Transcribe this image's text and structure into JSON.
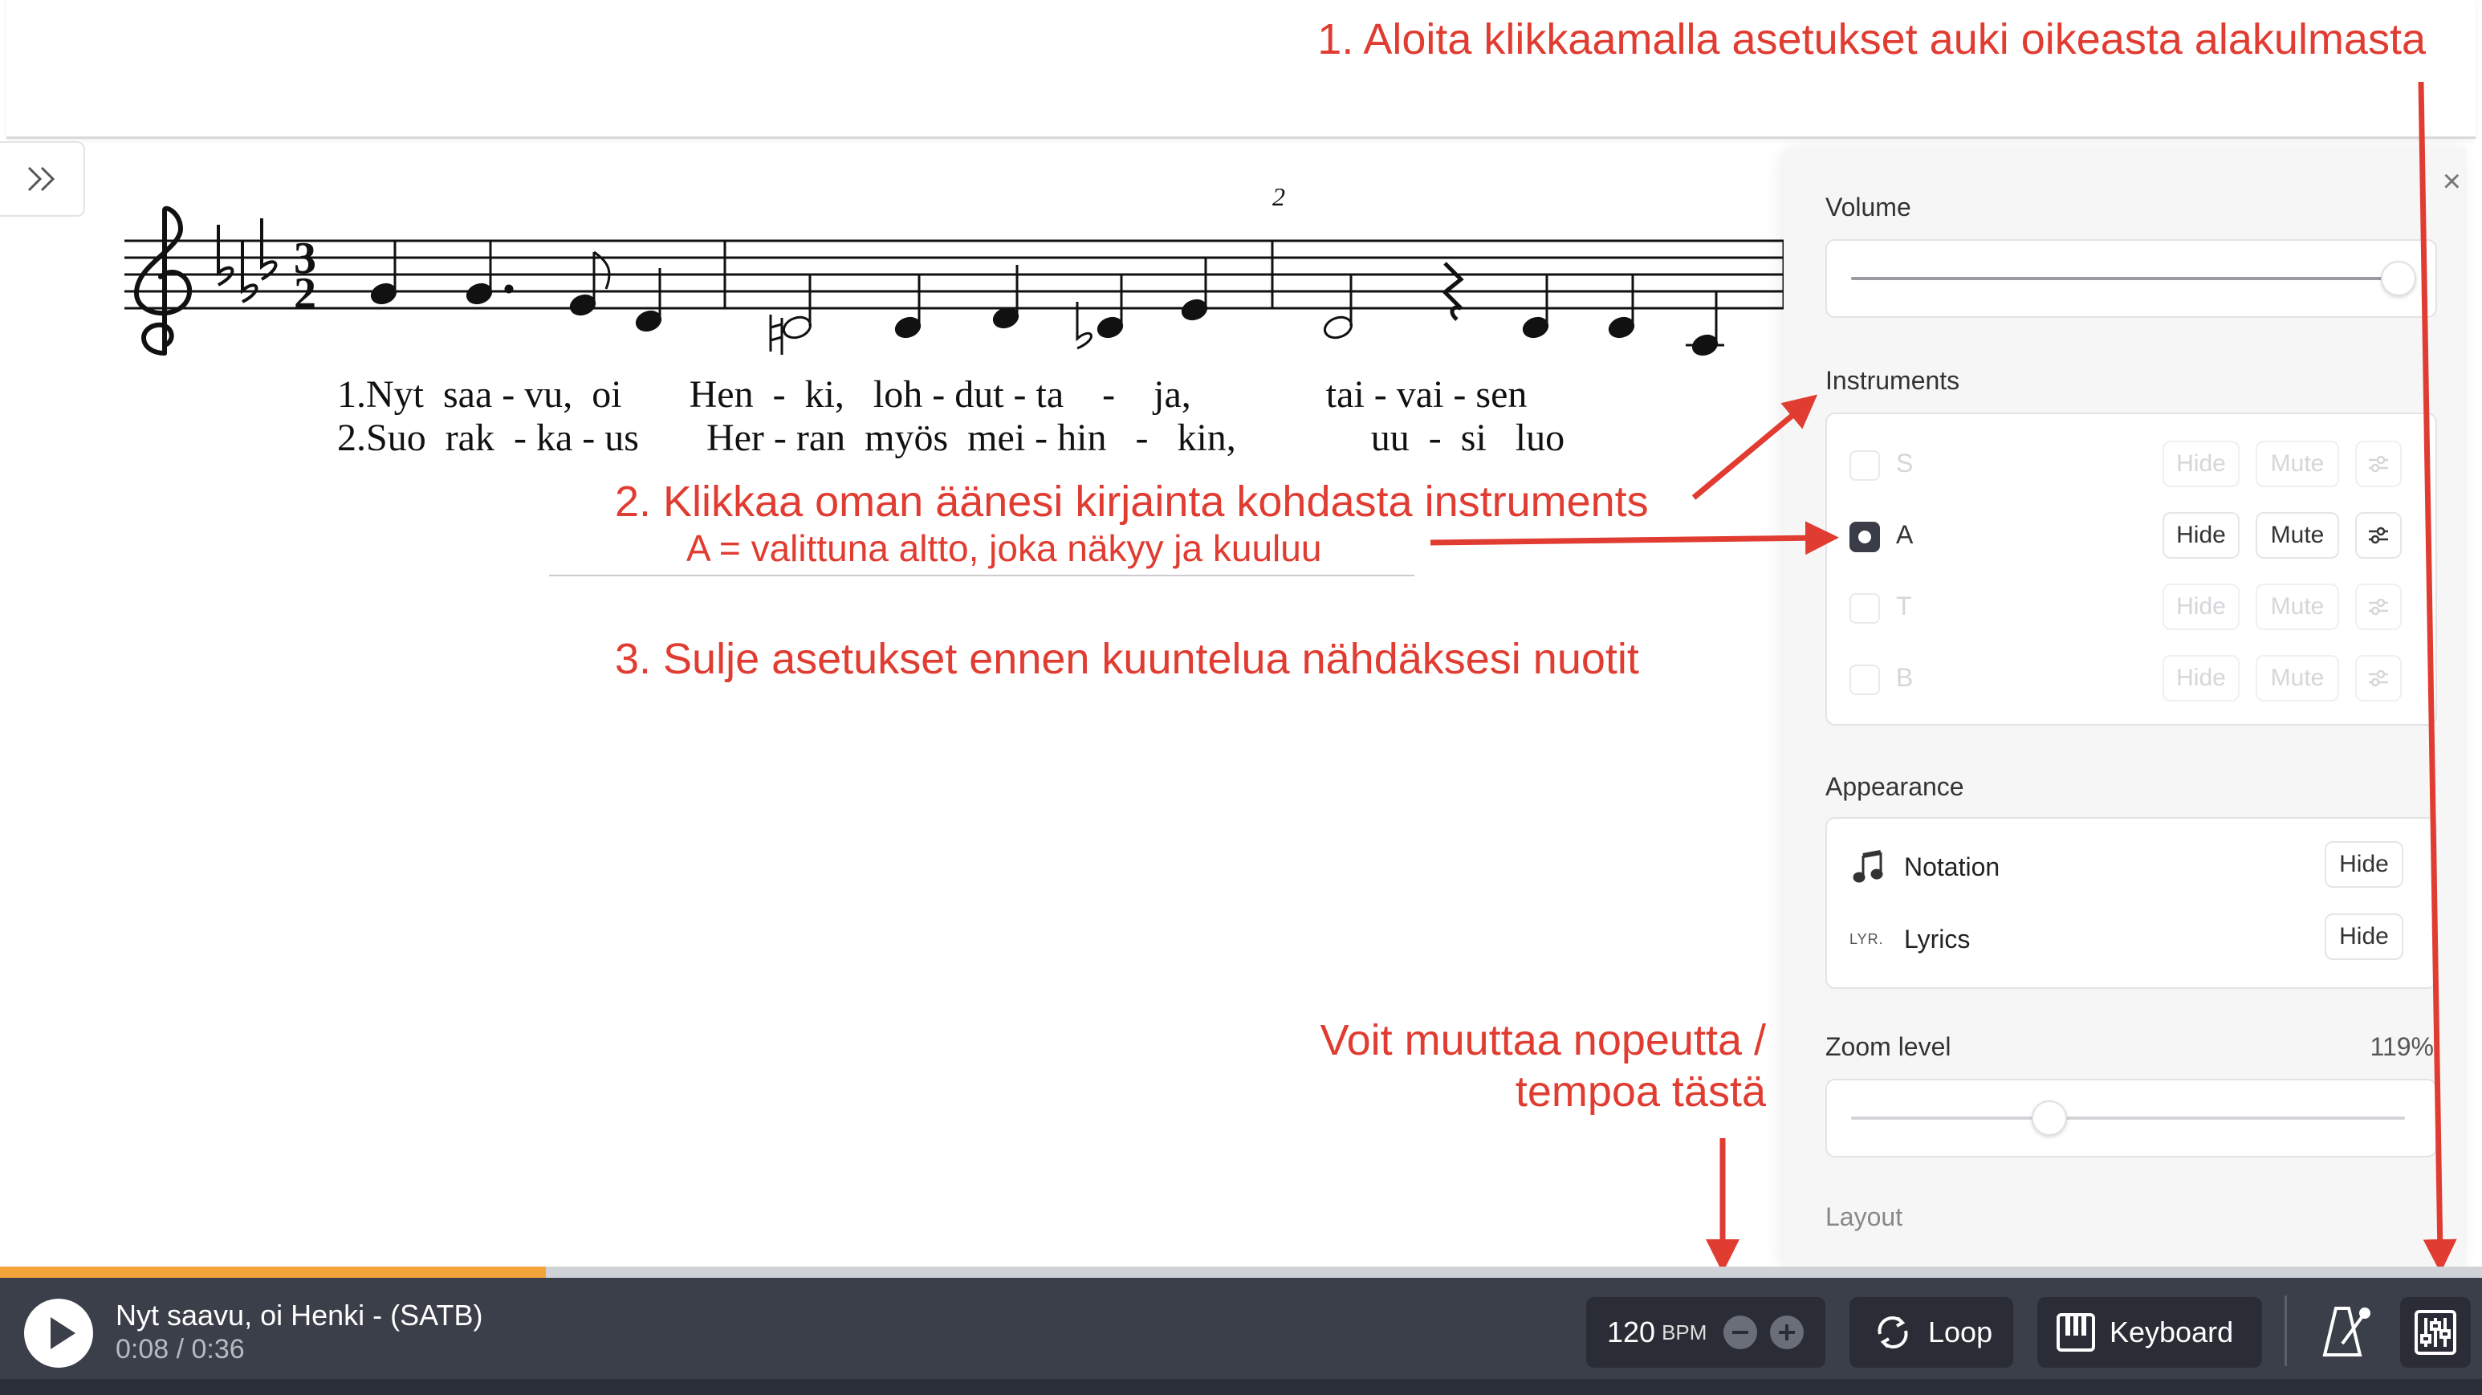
{
  "annotations": {
    "step1": "1. Aloita klikkaamalla asetukset auki oikeasta alakulmasta",
    "step2": "2. Klikkaa oman äänesi kirjainta kohdasta instruments",
    "step2_sub": "A = valittuna altto, joka näkyy ja kuuluu",
    "step3": "3. Sulje asetukset ennen kuuntelua nähdäksesi nuotit",
    "tempo_line1": "Voit muuttaa nopeutta /",
    "tempo_line2": "tempoa tästä"
  },
  "score": {
    "measure_number": "2",
    "lyrics_verse1": "1.Nyt  saa - vu,  oi       Hen  -  ki,   loh - dut - ta    -    ja,              tai - vai - sen",
    "lyrics_verse2": "2.Suo  rak  - ka - us       Her - ran  myös  mei - hin   -   kin,              uu  -  si   luo"
  },
  "settings": {
    "close_label": "×",
    "volume_heading": "Volume",
    "volume_level": 0.97,
    "instruments_heading": "Instruments",
    "instruments": [
      {
        "label": "S",
        "selected": false,
        "hide": "Hide",
        "mute": "Mute"
      },
      {
        "label": "A",
        "selected": true,
        "hide": "Hide",
        "mute": "Mute"
      },
      {
        "label": "T",
        "selected": false,
        "hide": "Hide",
        "mute": "Mute"
      },
      {
        "label": "B",
        "selected": false,
        "hide": "Hide",
        "mute": "Mute"
      }
    ],
    "appearance_heading": "Appearance",
    "notation_label": "Notation",
    "notation_hide": "Hide",
    "lyrics_icon_text": "LYR.",
    "lyrics_label": "Lyrics",
    "lyrics_hide": "Hide",
    "zoom_heading": "Zoom level",
    "zoom_value": "119%",
    "zoom_level": 0.36,
    "layout_heading": "Layout"
  },
  "player": {
    "title": "Nyt saavu, oi Henki - (SATB)",
    "time": "0:08 / 0:36",
    "progress": 0.22,
    "bpm_value": "120",
    "bpm_unit": "BPM",
    "loop_label": "Loop",
    "keyboard_label": "Keyboard"
  },
  "colors": {
    "annotation": "#e03c31",
    "player_bg": "#3b3f49",
    "progress": "#f2a33a",
    "panel_bg": "#f6f6f7"
  }
}
